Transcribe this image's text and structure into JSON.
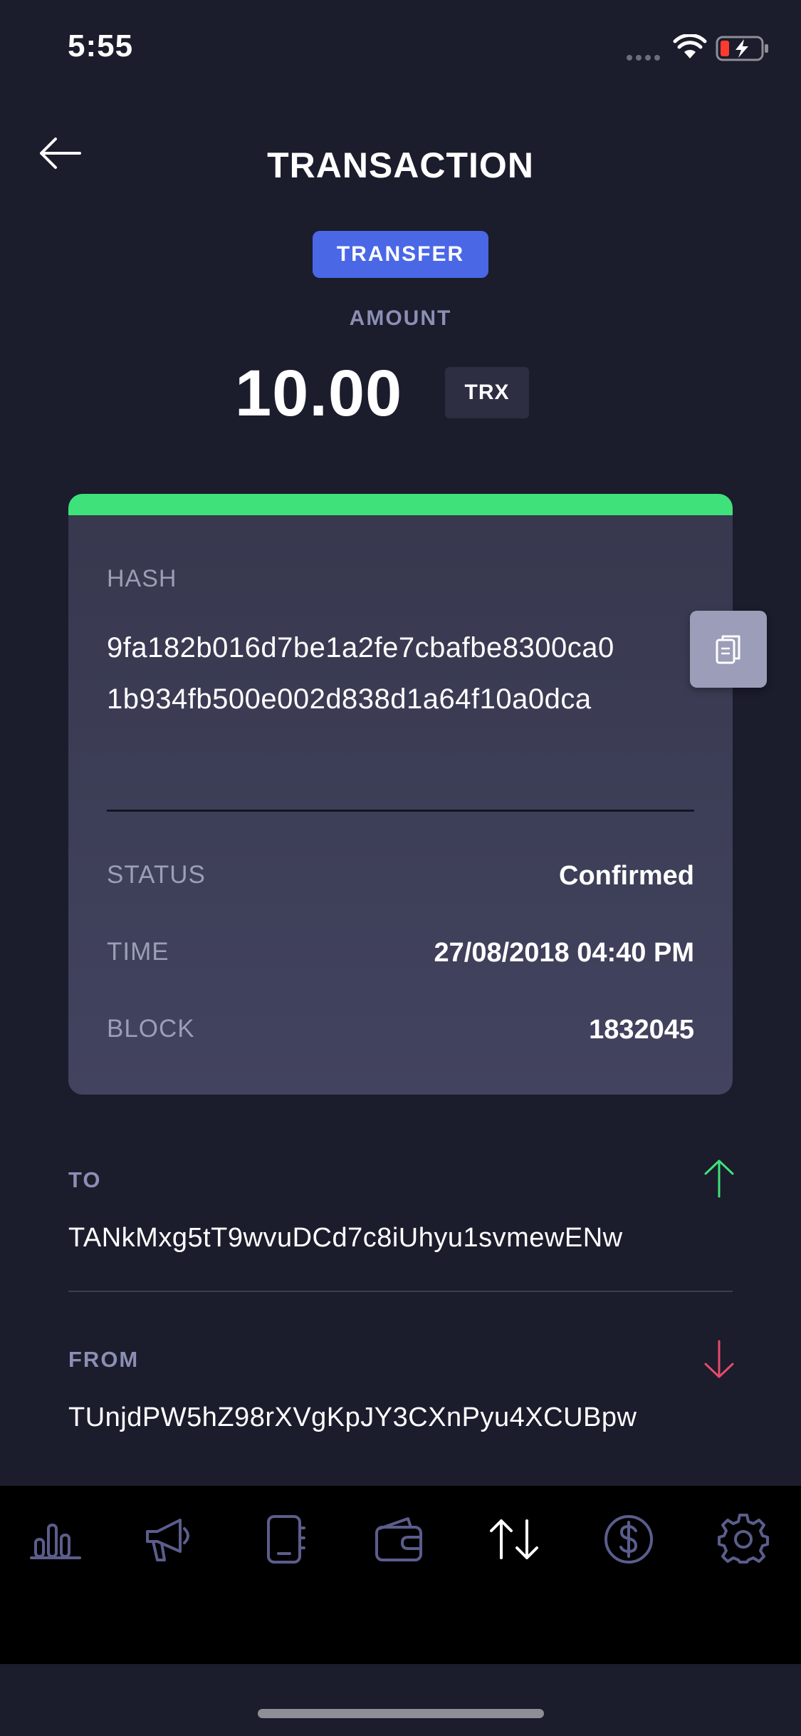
{
  "status_bar": {
    "time": "5:55"
  },
  "header": {
    "title": "TRANSACTION"
  },
  "transaction": {
    "type": "TRANSFER",
    "amount_label": "AMOUNT",
    "amount": "10.00",
    "currency": "TRX"
  },
  "details": {
    "hash_label": "HASH",
    "hash": "9fa182b016d7be1a2fe7cbafbe8300ca01b934fb500e002d838d1a64f10a0dca",
    "status_label": "STATUS",
    "status_value": "Confirmed",
    "time_label": "TIME",
    "time_value": "27/08/2018 04:40 PM",
    "block_label": "BLOCK",
    "block_value": "1832045"
  },
  "to": {
    "label": "TO",
    "address": "TANkMxg5tT9wvuDCd7c8iUhyu1svmewENw"
  },
  "from": {
    "label": "FROM",
    "address": "TUnjdPW5hZ98rXVgKpJY3CXnPyu4XCUBpw"
  },
  "colors": {
    "background": "#1b1c2c",
    "accent_blue": "#4a67e6",
    "success_green": "#3fe17a",
    "outgoing_red": "#e64a6a",
    "muted_label": "#8c8fb3",
    "tab_icon": "#5b5d8c"
  },
  "tab_bar": {
    "items": [
      {
        "icon": "chart-bars-icon"
      },
      {
        "icon": "megaphone-icon"
      },
      {
        "icon": "address-book-icon"
      },
      {
        "icon": "wallet-icon"
      },
      {
        "icon": "transactions-icon",
        "active": true
      },
      {
        "icon": "dollar-icon"
      },
      {
        "icon": "settings-icon"
      }
    ]
  }
}
